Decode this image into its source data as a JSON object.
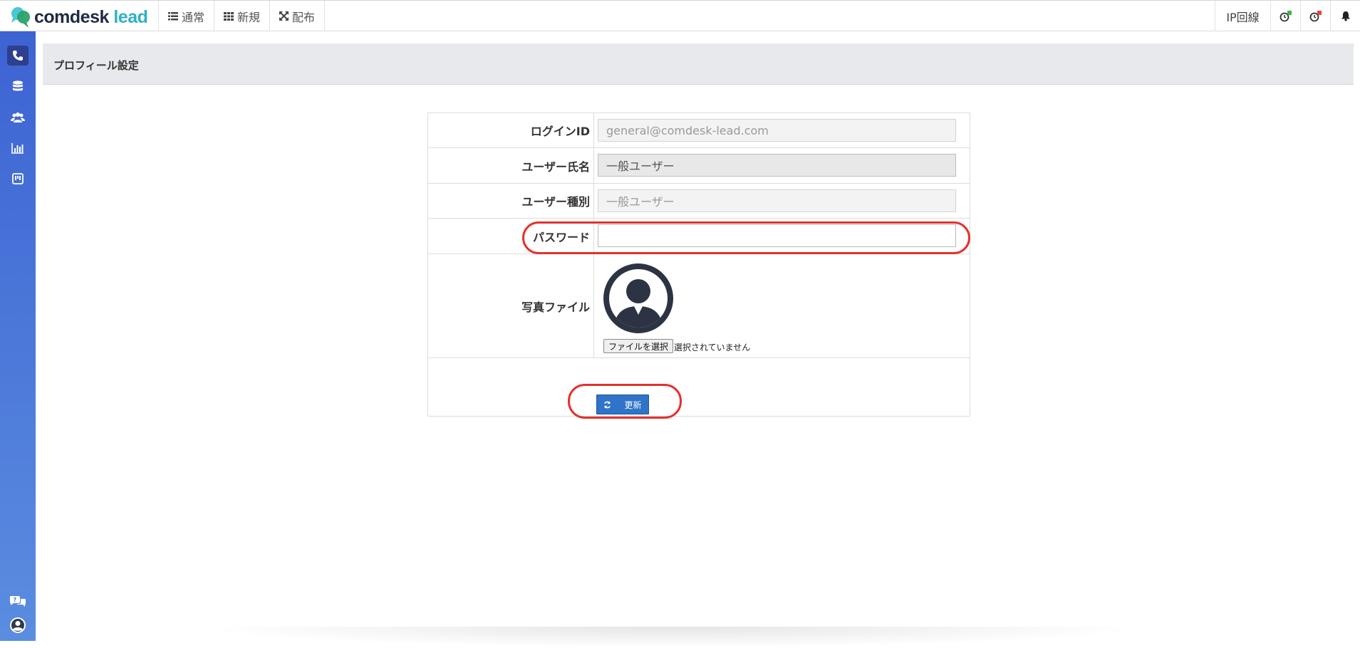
{
  "app": {
    "logo_main": "comdesk",
    "logo_accent": "lead"
  },
  "topnav": {
    "items": [
      {
        "label": "通常",
        "icon": "list-icon"
      },
      {
        "label": "新規",
        "icon": "grid-icon"
      },
      {
        "label": "配布",
        "icon": "expand-arrows-icon"
      }
    ],
    "ip_line": "IP回線",
    "indicator_colors": {
      "green": "#3cb44b",
      "red": "#e0453c"
    }
  },
  "sidebar": {
    "items": [
      "phone-icon",
      "database-icon",
      "users-icon",
      "bar-chart-icon",
      "board-icon"
    ],
    "bottom": [
      "chat-help-icon",
      "user-circle-icon"
    ]
  },
  "page": {
    "title": "プロフィール設定"
  },
  "form": {
    "login_id": {
      "label": "ログインID",
      "value": "general@comdesk-lead.com"
    },
    "user_name": {
      "label": "ユーザー氏名",
      "value": "一般ユーザー"
    },
    "user_type": {
      "label": "ユーザー種別",
      "value": "一般ユーザー"
    },
    "password": {
      "label": "パスワード",
      "value": ""
    },
    "photo": {
      "label": "写真ファイル",
      "button": "ファイルを選択",
      "status": "選択されていません"
    },
    "submit_label": "更新"
  },
  "colors": {
    "sidebar_top": "#3d63d2",
    "sidebar_bottom": "#5a8de0",
    "primary_button": "#2f74c8",
    "highlight_ring": "#e5312c"
  }
}
